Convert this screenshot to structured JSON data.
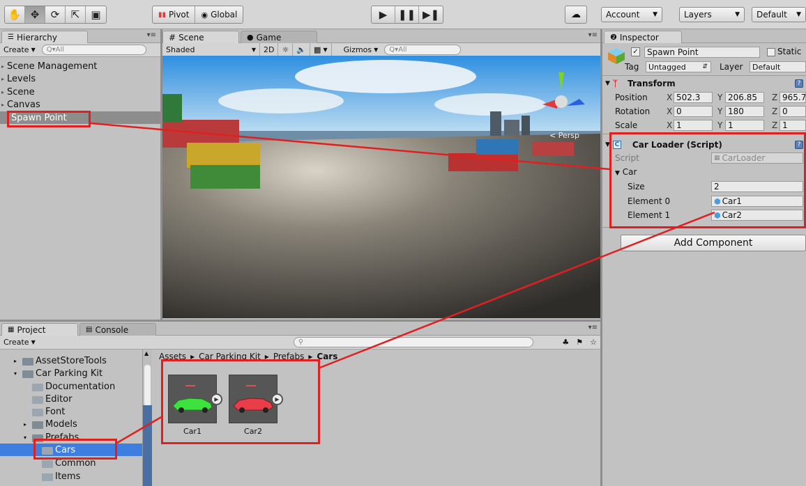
{
  "toolbar": {
    "tools": [
      "hand-tool",
      "move-tool",
      "rotate-tool",
      "scale-tool",
      "rect-tool"
    ],
    "pivot_label": "Pivot",
    "global_label": "Global",
    "account_label": "Account",
    "layers_label": "Layers",
    "layout_label": "Default"
  },
  "hierarchy": {
    "tab": "Hierarchy",
    "create": "Create",
    "search_placeholder": "Q▾All",
    "items": [
      "Scene Management",
      "Levels",
      "Scene",
      "Canvas",
      "Spawn Point"
    ]
  },
  "scene": {
    "tab_scene": "Scene",
    "tab_game": "Game",
    "shading": "Shaded",
    "mode_2d": "2D",
    "gizmos": "Gizmos",
    "search_placeholder": "Q▾All",
    "persp_label": "< Persp"
  },
  "inspector": {
    "tab": "Inspector",
    "object_name": "Spawn Point",
    "static_label": "Static",
    "tag_label": "Tag",
    "tag_value": "Untagged",
    "layer_label": "Layer",
    "layer_value": "Default",
    "transform": {
      "title": "Transform",
      "position_label": "Position",
      "rotation_label": "Rotation",
      "scale_label": "Scale",
      "position": {
        "x": "502.3",
        "y": "206.85",
        "z": "965.7"
      },
      "rotation": {
        "x": "0",
        "y": "180",
        "z": "0"
      },
      "scale": {
        "x": "1",
        "y": "1",
        "z": "1"
      }
    },
    "script_component": {
      "title": "Car Loader (Script)",
      "script_label": "Script",
      "script_value": "CarLoader",
      "array_label": "Car",
      "size_label": "Size",
      "size_value": "2",
      "elements": [
        {
          "label": "Element 0",
          "value": "Car1"
        },
        {
          "label": "Element 1",
          "value": "Car2"
        }
      ]
    },
    "add_component": "Add Component"
  },
  "project": {
    "tab_project": "Project",
    "tab_console": "Console",
    "create": "Create",
    "breadcrumb": [
      "Assets",
      "Car Parking Kit",
      "Prefabs",
      "Cars"
    ],
    "tree": [
      {
        "label": "AssetStoreTools",
        "indent": 1
      },
      {
        "label": "Car Parking Kit",
        "indent": 1
      },
      {
        "label": "Documentation",
        "indent": 2
      },
      {
        "label": "Editor",
        "indent": 2
      },
      {
        "label": "Font",
        "indent": 2
      },
      {
        "label": "Models",
        "indent": 2
      },
      {
        "label": "Prefabs",
        "indent": 2
      },
      {
        "label": "Cars",
        "indent": 3
      },
      {
        "label": "Common",
        "indent": 3
      },
      {
        "label": "Items",
        "indent": 3
      }
    ],
    "assets": [
      {
        "name": "Car1",
        "color": "#3ee23e"
      },
      {
        "name": "Car2",
        "color": "#ea3d4a"
      }
    ]
  },
  "colors": {
    "annotation": "#e02020",
    "selection": "#3e7ee0",
    "hierarchy_selection": "#8d8d8d"
  }
}
